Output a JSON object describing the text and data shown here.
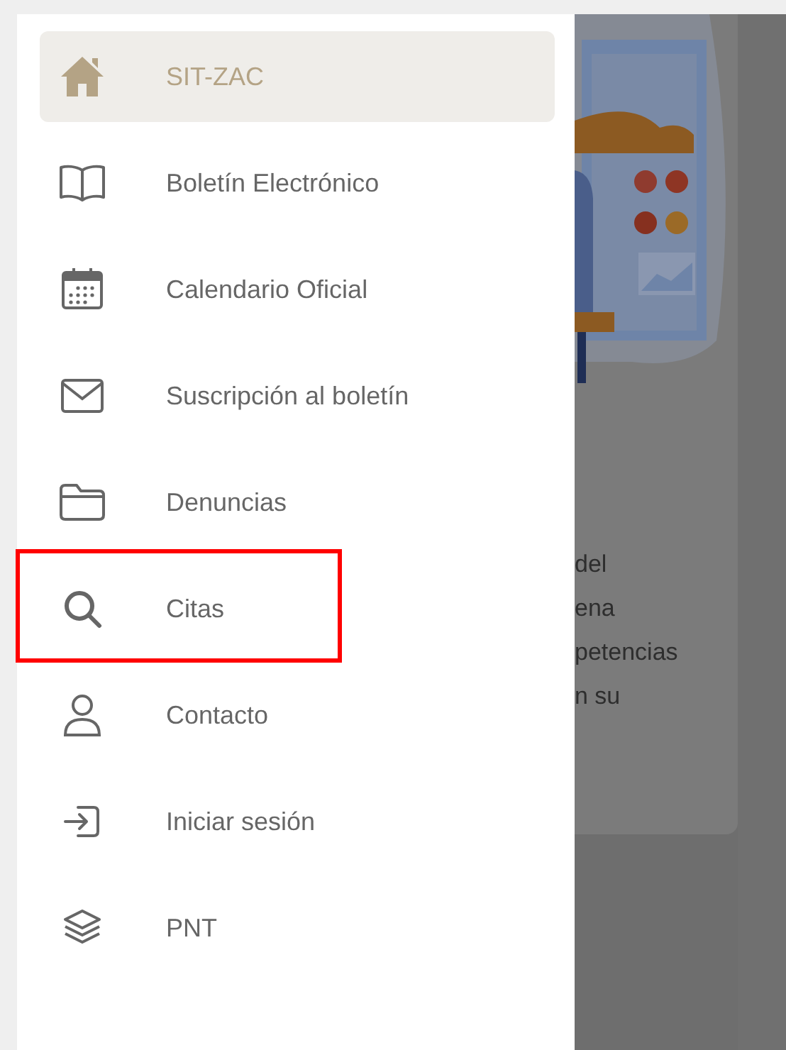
{
  "drawer": {
    "items": [
      {
        "label": "SIT-ZAC",
        "selected": true,
        "highlighted": false
      },
      {
        "label": "Boletín Electrónico",
        "selected": false,
        "highlighted": false
      },
      {
        "label": "Calendario Oficial",
        "selected": false,
        "highlighted": false
      },
      {
        "label": "Suscripción al boletín",
        "selected": false,
        "highlighted": false
      },
      {
        "label": "Denuncias",
        "selected": false,
        "highlighted": false
      },
      {
        "label": "Citas",
        "selected": false,
        "highlighted": true
      },
      {
        "label": "Contacto",
        "selected": false,
        "highlighted": false
      },
      {
        "label": "Iniciar sesión",
        "selected": false,
        "highlighted": false
      },
      {
        "label": "PNT",
        "selected": false,
        "highlighted": false
      }
    ]
  },
  "background": {
    "text_lines": [
      "del",
      "ena",
      "petencias",
      "n su"
    ]
  }
}
